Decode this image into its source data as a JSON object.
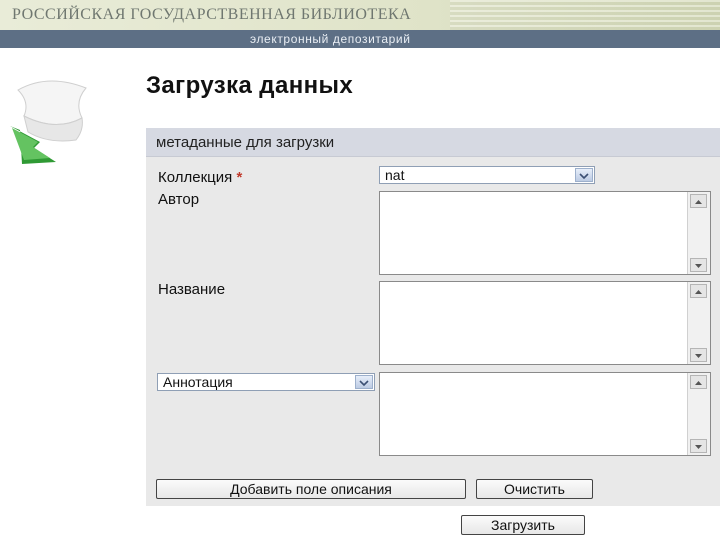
{
  "header": {
    "library_title": "РОССИЙСКАЯ ГОСУДАРСТВЕННАЯ БИБЛИОТЕКА",
    "subtitle": "электронный депозитарий"
  },
  "page": {
    "title": "Загрузка данных"
  },
  "form": {
    "section_title": "метаданные для загрузки",
    "collection": {
      "label": "Коллекция",
      "required_mark": "*",
      "value": "nat"
    },
    "author": {
      "label": "Автор"
    },
    "name": {
      "label": "Название"
    },
    "annotation": {
      "select_value": "Аннотация"
    },
    "buttons": {
      "add_field": "Добавить поле описания",
      "clear": "Очистить",
      "upload": "Загрузить"
    }
  },
  "icons": {
    "logo": "paper-with-green-arrow-icon",
    "dropdown": "chevron-down-icon",
    "scroll_up": "triangle-up-icon",
    "scroll_down": "triangle-down-icon"
  },
  "colors": {
    "subbar": "#5d6f85",
    "panel": "#e9e9e9",
    "panel_header": "#d6d9e2",
    "required": "#c0392b",
    "logo_green": "#2f9a34"
  }
}
